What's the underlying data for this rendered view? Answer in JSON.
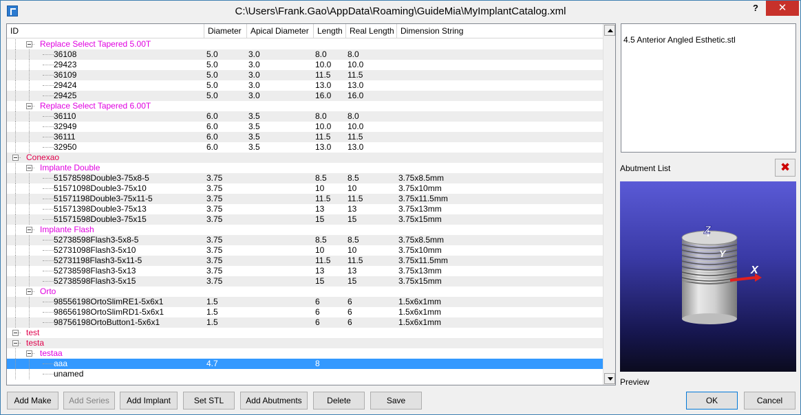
{
  "window": {
    "title": "C:\\Users\\Frank.Gao\\AppData\\Roaming\\GuideMia\\MyImplantCatalog.xml",
    "help_label": "?",
    "close_label": "✕"
  },
  "tree": {
    "columns": [
      "ID",
      "Diameter",
      "Apical Diameter",
      "Length",
      "Real Length",
      "Dimension String"
    ],
    "rows": [
      {
        "level": 1,
        "type": "series",
        "label": "Replace Select Tapered 5.00T",
        "dia": "",
        "apical": "",
        "len": "",
        "real": "",
        "dim": ""
      },
      {
        "level": 2,
        "type": "implant",
        "label": "36108",
        "dia": "5.0",
        "apical": "3.0",
        "len": "8.0",
        "real": "8.0",
        "dim": ""
      },
      {
        "level": 2,
        "type": "implant",
        "label": "29423",
        "dia": "5.0",
        "apical": "3.0",
        "len": "10.0",
        "real": "10.0",
        "dim": ""
      },
      {
        "level": 2,
        "type": "implant",
        "label": "36109",
        "dia": "5.0",
        "apical": "3.0",
        "len": "11.5",
        "real": "11.5",
        "dim": ""
      },
      {
        "level": 2,
        "type": "implant",
        "label": "29424",
        "dia": "5.0",
        "apical": "3.0",
        "len": "13.0",
        "real": "13.0",
        "dim": ""
      },
      {
        "level": 2,
        "type": "implant",
        "label": "29425",
        "dia": "5.0",
        "apical": "3.0",
        "len": "16.0",
        "real": "16.0",
        "dim": ""
      },
      {
        "level": 1,
        "type": "series",
        "label": "Replace Select Tapered 6.00T",
        "dia": "",
        "apical": "",
        "len": "",
        "real": "",
        "dim": ""
      },
      {
        "level": 2,
        "type": "implant",
        "label": "36110",
        "dia": "6.0",
        "apical": "3.5",
        "len": "8.0",
        "real": "8.0",
        "dim": ""
      },
      {
        "level": 2,
        "type": "implant",
        "label": "32949",
        "dia": "6.0",
        "apical": "3.5",
        "len": "10.0",
        "real": "10.0",
        "dim": ""
      },
      {
        "level": 2,
        "type": "implant",
        "label": "36111",
        "dia": "6.0",
        "apical": "3.5",
        "len": "11.5",
        "real": "11.5",
        "dim": ""
      },
      {
        "level": 2,
        "type": "implant",
        "label": "32950",
        "dia": "6.0",
        "apical": "3.5",
        "len": "13.0",
        "real": "13.0",
        "dim": ""
      },
      {
        "level": 0,
        "type": "make",
        "label": "Conexao",
        "dia": "",
        "apical": "",
        "len": "",
        "real": "",
        "dim": ""
      },
      {
        "level": 1,
        "type": "series",
        "label": "Implante Double",
        "dia": "",
        "apical": "",
        "len": "",
        "real": "",
        "dim": ""
      },
      {
        "level": 2,
        "type": "implant",
        "label": "51578598Double3-75x8-5",
        "dia": "3.75",
        "apical": "",
        "len": "8.5",
        "real": "8.5",
        "dim": "3.75x8.5mm"
      },
      {
        "level": 2,
        "type": "implant",
        "label": "51571098Double3-75x10",
        "dia": "3.75",
        "apical": "",
        "len": "10",
        "real": "10",
        "dim": "3.75x10mm"
      },
      {
        "level": 2,
        "type": "implant",
        "label": "51571198Double3-75x11-5",
        "dia": "3.75",
        "apical": "",
        "len": "11.5",
        "real": "11.5",
        "dim": "3.75x11.5mm"
      },
      {
        "level": 2,
        "type": "implant",
        "label": "51571398Double3-75x13",
        "dia": "3.75",
        "apical": "",
        "len": "13",
        "real": "13",
        "dim": "3.75x13mm"
      },
      {
        "level": 2,
        "type": "implant",
        "label": "51571598Double3-75x15",
        "dia": "3.75",
        "apical": "",
        "len": "15",
        "real": "15",
        "dim": "3.75x15mm"
      },
      {
        "level": 1,
        "type": "series",
        "label": "Implante Flash",
        "dia": "",
        "apical": "",
        "len": "",
        "real": "",
        "dim": ""
      },
      {
        "level": 2,
        "type": "implant",
        "label": "52738598Flash3-5x8-5",
        "dia": "3.75",
        "apical": "",
        "len": "8.5",
        "real": "8.5",
        "dim": "3.75x8.5mm"
      },
      {
        "level": 2,
        "type": "implant",
        "label": "52731098Flash3-5x10",
        "dia": "3.75",
        "apical": "",
        "len": "10",
        "real": "10",
        "dim": "3.75x10mm"
      },
      {
        "level": 2,
        "type": "implant",
        "label": "52731198Flash3-5x11-5",
        "dia": "3.75",
        "apical": "",
        "len": "11.5",
        "real": "11.5",
        "dim": "3.75x11.5mm"
      },
      {
        "level": 2,
        "type": "implant",
        "label": "52738598Flash3-5x13",
        "dia": "3.75",
        "apical": "",
        "len": "13",
        "real": "13",
        "dim": "3.75x13mm"
      },
      {
        "level": 2,
        "type": "implant",
        "label": "52738598Flash3-5x15",
        "dia": "3.75",
        "apical": "",
        "len": "15",
        "real": "15",
        "dim": "3.75x15mm"
      },
      {
        "level": 1,
        "type": "series",
        "label": "Orto",
        "dia": "",
        "apical": "",
        "len": "",
        "real": "",
        "dim": ""
      },
      {
        "level": 2,
        "type": "implant",
        "label": "98556198OrtoSlimRE1-5x6x1",
        "dia": "1.5",
        "apical": "",
        "len": "6",
        "real": "6",
        "dim": "1.5x6x1mm"
      },
      {
        "level": 2,
        "type": "implant",
        "label": "98656198OrtoSlimRD1-5x6x1",
        "dia": "1.5",
        "apical": "",
        "len": "6",
        "real": "6",
        "dim": "1.5x6x1mm"
      },
      {
        "level": 2,
        "type": "implant",
        "label": "98756198OrtoButton1-5x6x1",
        "dia": "1.5",
        "apical": "",
        "len": "6",
        "real": "6",
        "dim": "1.5x6x1mm"
      },
      {
        "level": 0,
        "type": "make",
        "label": "test",
        "dia": "",
        "apical": "",
        "len": "",
        "real": "",
        "dim": ""
      },
      {
        "level": 0,
        "type": "make",
        "label": "testa",
        "dia": "",
        "apical": "",
        "len": "",
        "real": "",
        "dim": ""
      },
      {
        "level": 1,
        "type": "series",
        "label": "testaa",
        "dia": "",
        "apical": "",
        "len": "",
        "real": "",
        "dim": ""
      },
      {
        "level": 2,
        "type": "implant",
        "label": "aaa",
        "dia": "4.7",
        "apical": "",
        "len": "8",
        "real": "",
        "dim": "",
        "selected": true
      },
      {
        "level": 2,
        "type": "implant",
        "label": "unamed",
        "dia": "",
        "apical": "",
        "len": "",
        "real": "",
        "dim": ""
      }
    ]
  },
  "right_panel": {
    "stl_file": "4.5 Anterior Angled Esthetic.stl",
    "abutment_list_label": "Abutment List",
    "preview_label": "Preview",
    "axis_labels": {
      "z": "Z",
      "y": "Y",
      "x": "X"
    }
  },
  "buttons": {
    "add_make": "Add Make",
    "add_series": "Add Series",
    "add_implant": "Add Implant",
    "set_stl": "Set STL",
    "add_abutments": "Add Abutments",
    "delete": "Delete",
    "save": "Save",
    "ok": "OK",
    "cancel": "Cancel"
  },
  "colors": {
    "make_text": "#e0004b",
    "series_text": "#e000e0",
    "selection": "#3399ff",
    "close_button": "#c7312a"
  }
}
